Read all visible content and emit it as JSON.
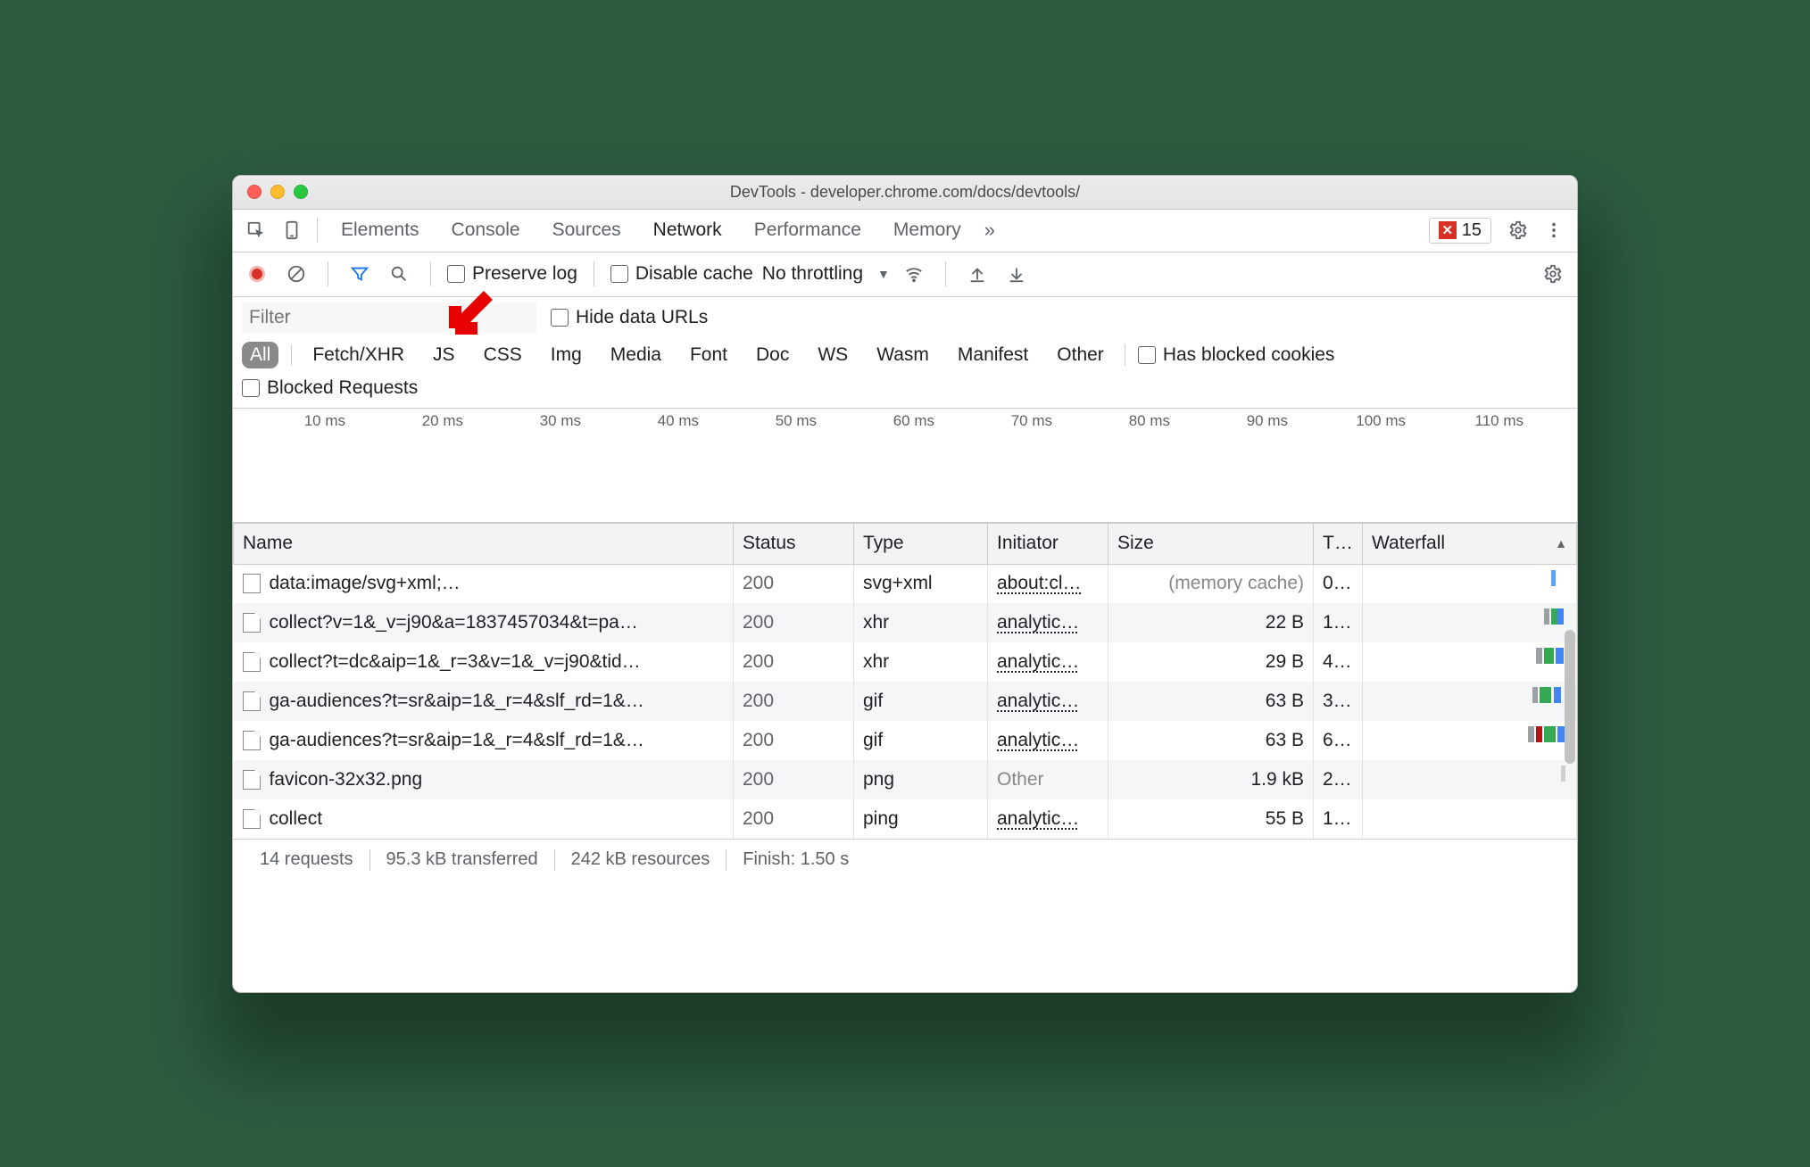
{
  "window": {
    "title": "DevTools - developer.chrome.com/docs/devtools/"
  },
  "tabs": {
    "items": [
      "Elements",
      "Console",
      "Sources",
      "Network",
      "Performance",
      "Memory"
    ],
    "active_index": 3,
    "error_count": "15"
  },
  "netbar": {
    "preserve_log": "Preserve log",
    "disable_cache": "Disable cache",
    "throttling": "No throttling"
  },
  "filter": {
    "placeholder": "Filter",
    "hide_data_urls": "Hide data URLs",
    "types": [
      "All",
      "Fetch/XHR",
      "JS",
      "CSS",
      "Img",
      "Media",
      "Font",
      "Doc",
      "WS",
      "Wasm",
      "Manifest",
      "Other"
    ],
    "active_type_index": 0,
    "has_blocked_cookies": "Has blocked cookies",
    "blocked_requests": "Blocked Requests"
  },
  "timeline_ticks": [
    "10 ms",
    "20 ms",
    "30 ms",
    "40 ms",
    "50 ms",
    "60 ms",
    "70 ms",
    "80 ms",
    "90 ms",
    "100 ms",
    "110 ms"
  ],
  "cols": {
    "name": "Name",
    "status": "Status",
    "type": "Type",
    "initiator": "Initiator",
    "size": "Size",
    "time": "T…",
    "waterfall": "Waterfall"
  },
  "rows": [
    {
      "icon": "doc",
      "name": "data:image/svg+xml;…",
      "status": "200",
      "type": "svg+xml",
      "initiator": "about:cl…",
      "initiator_link": true,
      "size": "(memory cache)",
      "size_muted": true,
      "time": "0…",
      "wf": [
        {
          "l": 92,
          "w": 2,
          "c": "#5aa2ff"
        }
      ]
    },
    {
      "icon": "file",
      "name": "collect?v=1&_v=j90&a=1837457034&t=pa…",
      "status": "200",
      "type": "xhr",
      "initiator": "analytic…",
      "initiator_link": true,
      "size": "22 B",
      "time": "1…",
      "wf": [
        {
          "l": 88,
          "w": 3,
          "c": "#9aa0a6"
        },
        {
          "l": 92,
          "w": 3,
          "c": "#34a853"
        },
        {
          "l": 95,
          "w": 3,
          "c": "#4285f4"
        }
      ]
    },
    {
      "icon": "file",
      "name": "collect?t=dc&aip=1&_r=3&v=1&_v=j90&tid…",
      "status": "200",
      "type": "xhr",
      "initiator": "analytic…",
      "initiator_link": true,
      "size": "29 B",
      "time": "4…",
      "wf": [
        {
          "l": 84,
          "w": 3,
          "c": "#9aa0a6"
        },
        {
          "l": 88,
          "w": 5,
          "c": "#34a853"
        },
        {
          "l": 94,
          "w": 4,
          "c": "#4285f4"
        }
      ]
    },
    {
      "icon": "file",
      "name": "ga-audiences?t=sr&aip=1&_r=4&slf_rd=1&…",
      "status": "200",
      "type": "gif",
      "initiator": "analytic…",
      "initiator_link": true,
      "size": "63 B",
      "time": "3…",
      "wf": [
        {
          "l": 82,
          "w": 3,
          "c": "#9aa0a6"
        },
        {
          "l": 86,
          "w": 6,
          "c": "#34a853"
        },
        {
          "l": 93,
          "w": 4,
          "c": "#4285f4"
        }
      ]
    },
    {
      "icon": "file",
      "name": "ga-audiences?t=sr&aip=1&_r=4&slf_rd=1&…",
      "status": "200",
      "type": "gif",
      "initiator": "analytic…",
      "initiator_link": true,
      "size": "63 B",
      "time": "6…",
      "wf": [
        {
          "l": 80,
          "w": 3,
          "c": "#9aa0a6"
        },
        {
          "l": 84,
          "w": 3,
          "c": "#b31412"
        },
        {
          "l": 88,
          "w": 6,
          "c": "#34a853"
        },
        {
          "l": 95,
          "w": 4,
          "c": "#4285f4"
        }
      ]
    },
    {
      "icon": "file",
      "name": "favicon-32x32.png",
      "status": "200",
      "type": "png",
      "initiator": "Other",
      "initiator_link": false,
      "size": "1.9 kB",
      "time": "2…",
      "wf": [
        {
          "l": 97,
          "w": 2,
          "c": "#cfcfcf"
        }
      ]
    },
    {
      "icon": "file",
      "name": "collect",
      "status": "200",
      "type": "ping",
      "initiator": "analytic…",
      "initiator_link": true,
      "size": "55 B",
      "time": "1…",
      "wf": []
    }
  ],
  "footer": {
    "requests": "14 requests",
    "transferred": "95.3 kB transferred",
    "resources": "242 kB resources",
    "finish": "Finish: 1.50 s"
  }
}
